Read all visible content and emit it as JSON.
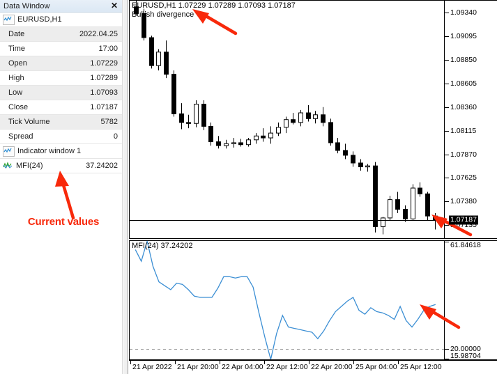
{
  "panel": {
    "title": "Data Window",
    "close_label": "✕",
    "symbol_group": "EURUSD,H1",
    "symbol_group_icon": "chart-wave-icon",
    "rows": [
      {
        "label": "Date",
        "value": "2022.04.25"
      },
      {
        "label": "Time",
        "value": "17:00"
      },
      {
        "label": "Open",
        "value": "1.07229"
      },
      {
        "label": "High",
        "value": "1.07289"
      },
      {
        "label": "Low",
        "value": "1.07093"
      },
      {
        "label": "Close",
        "value": "1.07187"
      },
      {
        "label": "Tick Volume",
        "value": "5782"
      },
      {
        "label": "Spread",
        "value": "0"
      }
    ],
    "indicator_group": "Indicator window 1",
    "indicator_group_icon": "chart-wave-icon",
    "indicator_rows": [
      {
        "label": "MFI(24)",
        "value": "37.24202",
        "icon": "indicator-wave-icon"
      }
    ],
    "annotation": "Current values",
    "annotation_color": "#f8290b"
  },
  "chart": {
    "header": "EURUSD,H1  1.07229 1.07289 1.07093 1.07187",
    "divergence_label": "Bullish divergence",
    "symbol": "EURUSD",
    "timeframe": "H1",
    "current_price_tag": "1.07187",
    "bull_candle_color": "#ffffff",
    "bear_candle_color": "#000000",
    "candle_outline_color": "#000000",
    "price_line_color": "#000000",
    "price_labels": [
      "1.09340",
      "1.09095",
      "1.08850",
      "1.08605",
      "1.08360",
      "1.08115",
      "1.07870",
      "1.07625",
      "1.07380",
      "1.07135"
    ],
    "time_labels": [
      "21 Apr 2022",
      "21 Apr 20:00",
      "22 Apr 04:00",
      "22 Apr 12:00",
      "22 Apr 20:00",
      "25 Apr 04:00",
      "25 Apr 12:00"
    ]
  },
  "indicator": {
    "header": "MFI(24) 37.24202",
    "name": "MFI",
    "period": "24",
    "value": "37.24202",
    "line_color": "#3c8fd4",
    "level_line_color": "#999999",
    "scale_labels": [
      "61.84618",
      "20.00000",
      "15.98704"
    ]
  },
  "chart_data": {
    "type": "candlestick",
    "title": "EURUSD,H1  1.07229 1.07289 1.07093 1.07187",
    "xlabel": "",
    "ylabel": "",
    "ylim": [
      1.07,
      1.09463
    ],
    "price_ticks": [
      1.0934,
      1.09095,
      1.0885,
      1.08605,
      1.0836,
      1.08115,
      1.0787,
      1.07625,
      1.0738,
      1.07135
    ],
    "x_ticks": [
      "21 Apr 2022",
      "21 Apr 20:00",
      "22 Apr 04:00",
      "22 Apr 12:00",
      "22 Apr 20:00",
      "25 Apr 04:00",
      "25 Apr 12:00"
    ],
    "current_price": 1.07187,
    "grid": false,
    "legend": "none",
    "candles": [
      {
        "o": 1.094,
        "h": 1.09463,
        "l": 1.0931,
        "c": 1.0933
      },
      {
        "o": 1.0933,
        "h": 1.0938,
        "l": 1.0905,
        "c": 1.0908
      },
      {
        "o": 1.0908,
        "h": 1.091,
        "l": 1.0876,
        "c": 1.0879
      },
      {
        "o": 1.0879,
        "h": 1.0896,
        "l": 1.0874,
        "c": 1.0893
      },
      {
        "o": 1.0893,
        "h": 1.0905,
        "l": 1.0866,
        "c": 1.087
      },
      {
        "o": 1.087,
        "h": 1.0874,
        "l": 1.0826,
        "c": 1.0829
      },
      {
        "o": 1.0829,
        "h": 1.084,
        "l": 1.0813,
        "c": 1.082
      },
      {
        "o": 1.082,
        "h": 1.0828,
        "l": 1.0814,
        "c": 1.0819
      },
      {
        "o": 1.0819,
        "h": 1.0843,
        "l": 1.0815,
        "c": 1.0839
      },
      {
        "o": 1.0839,
        "h": 1.0843,
        "l": 1.0812,
        "c": 1.0816
      },
      {
        "o": 1.0816,
        "h": 1.082,
        "l": 1.0796,
        "c": 1.08
      },
      {
        "o": 1.08,
        "h": 1.0806,
        "l": 1.0793,
        "c": 1.0796
      },
      {
        "o": 1.0796,
        "h": 1.0802,
        "l": 1.0793,
        "c": 1.0798
      },
      {
        "o": 1.0798,
        "h": 1.0804,
        "l": 1.0794,
        "c": 1.0799
      },
      {
        "o": 1.0799,
        "h": 1.0803,
        "l": 1.0795,
        "c": 1.0797
      },
      {
        "o": 1.0797,
        "h": 1.0804,
        "l": 1.0795,
        "c": 1.0802
      },
      {
        "o": 1.0802,
        "h": 1.0809,
        "l": 1.0798,
        "c": 1.0806
      },
      {
        "o": 1.0806,
        "h": 1.0814,
        "l": 1.08,
        "c": 1.0804
      },
      {
        "o": 1.0804,
        "h": 1.0816,
        "l": 1.0798,
        "c": 1.0809
      },
      {
        "o": 1.0809,
        "h": 1.082,
        "l": 1.0806,
        "c": 1.0815
      },
      {
        "o": 1.0815,
        "h": 1.0826,
        "l": 1.0809,
        "c": 1.0823
      },
      {
        "o": 1.0823,
        "h": 1.083,
        "l": 1.0818,
        "c": 1.082
      },
      {
        "o": 1.082,
        "h": 1.0833,
        "l": 1.0816,
        "c": 1.083
      },
      {
        "o": 1.083,
        "h": 1.0838,
        "l": 1.0821,
        "c": 1.0824
      },
      {
        "o": 1.0824,
        "h": 1.0832,
        "l": 1.0819,
        "c": 1.0828
      },
      {
        "o": 1.0828,
        "h": 1.0836,
        "l": 1.0816,
        "c": 1.082
      },
      {
        "o": 1.082,
        "h": 1.0824,
        "l": 1.0796,
        "c": 1.0799
      },
      {
        "o": 1.0799,
        "h": 1.0804,
        "l": 1.0788,
        "c": 1.0791
      },
      {
        "o": 1.0791,
        "h": 1.0798,
        "l": 1.0782,
        "c": 1.0786
      },
      {
        "o": 1.0786,
        "h": 1.079,
        "l": 1.0774,
        "c": 1.0778
      },
      {
        "o": 1.0778,
        "h": 1.0782,
        "l": 1.077,
        "c": 1.0774
      },
      {
        "o": 1.0774,
        "h": 1.0777,
        "l": 1.0769,
        "c": 1.0775
      },
      {
        "o": 1.0775,
        "h": 1.0779,
        "l": 1.0706,
        "c": 1.0712
      },
      {
        "o": 1.0712,
        "h": 1.0722,
        "l": 1.0704,
        "c": 1.0721
      },
      {
        "o": 1.0721,
        "h": 1.0744,
        "l": 1.0718,
        "c": 1.074
      },
      {
        "o": 1.074,
        "h": 1.0748,
        "l": 1.0726,
        "c": 1.073
      },
      {
        "o": 1.073,
        "h": 1.0734,
        "l": 1.0717,
        "c": 1.072
      },
      {
        "o": 1.072,
        "h": 1.0756,
        "l": 1.0718,
        "c": 1.0752
      },
      {
        "o": 1.0752,
        "h": 1.0758,
        "l": 1.0743,
        "c": 1.0746
      },
      {
        "o": 1.0746,
        "h": 1.0748,
        "l": 1.0718,
        "c": 1.0723
      },
      {
        "o": 1.0723,
        "h": 1.0726,
        "l": 1.0709,
        "c": 1.07187
      }
    ],
    "indicator_subplot": {
      "type": "line",
      "name": "MFI(24)",
      "value": 37.24202,
      "ylim": [
        15.98704,
        61.84618
      ],
      "level_lines": [
        20.0
      ],
      "y_ticks": [
        61.84618,
        20.0,
        15.98704
      ],
      "values": [
        58.5,
        54.0,
        61.8,
        52.0,
        46.0,
        44.5,
        43.0,
        45.5,
        45.0,
        43.0,
        40.5,
        40.0,
        40.0,
        40.0,
        43.5,
        48.0,
        48.0,
        47.5,
        48.0,
        48.0,
        44.0,
        34.0,
        24.5,
        16.0,
        26.0,
        33.0,
        28.5,
        28.0,
        27.5,
        27.0,
        26.5,
        24.0,
        27.0,
        31.0,
        34.5,
        36.5,
        38.5,
        40.0,
        35.0,
        33.5,
        36.0,
        34.5,
        34.0,
        33.0,
        31.5,
        36.5,
        31.0,
        28.5,
        31.5,
        35.0,
        36.5,
        37.24202
      ]
    }
  },
  "annotations": [
    {
      "name": "header-arrow",
      "color": "#f8290b"
    },
    {
      "name": "panel-arrow",
      "color": "#f8290b"
    },
    {
      "name": "price-arrow",
      "color": "#f8290b"
    },
    {
      "name": "indicator-arrow",
      "color": "#f8290b"
    }
  ]
}
